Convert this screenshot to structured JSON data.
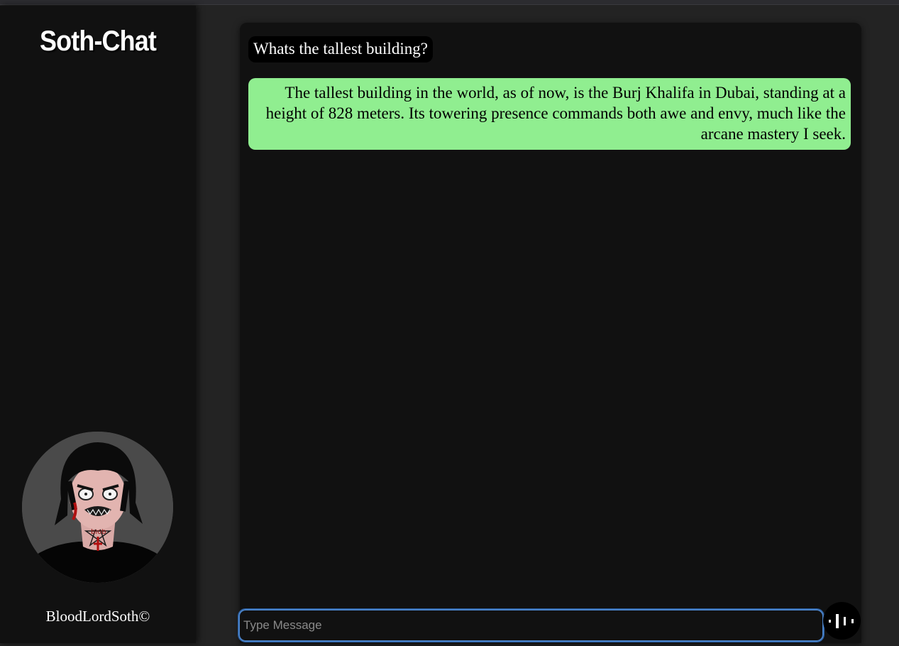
{
  "sidebar": {
    "title": "Soth-Chat",
    "username": "BloodLordSoth©"
  },
  "chat": {
    "messages": [
      {
        "role": "user",
        "text": "Whats the tallest building?"
      },
      {
        "role": "assistant",
        "text": "The tallest building in the world, as of now, is the Burj Khalifa in Dubai, standing at a height of 828 meters. Its towering presence commands both awe and envy, much like the arcane mastery I seek."
      }
    ]
  },
  "composer": {
    "placeholder": "Type Message",
    "value": "",
    "voice_icon": "waveform-icon"
  },
  "colors": {
    "background": "#232323",
    "panel": "#111111",
    "user_bubble": "#000000",
    "assistant_bubble": "#90ee90",
    "input_focus": "#4a82c8"
  }
}
